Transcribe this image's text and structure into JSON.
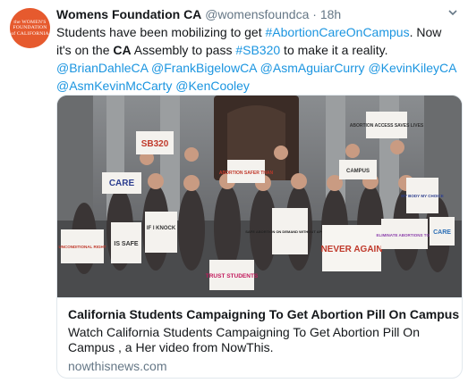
{
  "avatar": {
    "lines": [
      "the WOMEN'S",
      "FOUNDATION",
      "of CALIFORNIA"
    ]
  },
  "tweet": {
    "author_name": "Womens Foundation CA",
    "author_handle": "@womensfoundca",
    "separator": "·",
    "timestamp": "18h",
    "text_parts": [
      {
        "t": "Students have been mobilizing to get ",
        "k": "plain"
      },
      {
        "t": "#AbortionCareOnCampus",
        "k": "link"
      },
      {
        "t": ". Now it's on the ",
        "k": "plain"
      },
      {
        "t": "CA",
        "k": "bold"
      },
      {
        "t": " Assembly to pass ",
        "k": "plain"
      },
      {
        "t": "#SB320",
        "k": "link"
      },
      {
        "t": " to make it a reality. ",
        "k": "plain"
      },
      {
        "t": "@BrianDahleCA",
        "k": "link"
      },
      {
        "t": " ",
        "k": "plain"
      },
      {
        "t": "@FrankBigelowCA",
        "k": "link"
      },
      {
        "t": " ",
        "k": "plain"
      },
      {
        "t": "@AsmAguiarCurry",
        "k": "link"
      },
      {
        "t": "  ",
        "k": "plain"
      },
      {
        "t": "@KevinKileyCA",
        "k": "link"
      },
      {
        "t": " ",
        "k": "plain"
      },
      {
        "t": "@AsmKevinMcCarty",
        "k": "link"
      },
      {
        "t": " ",
        "k": "plain"
      },
      {
        "t": "@KenCooley",
        "k": "link"
      }
    ]
  },
  "card": {
    "title": "California Students Campaigning To Get Abortion Pill On Campus",
    "description": "Watch California Students Campaigning To Get Abortion Pill On Campus , a Her video from NowThis.",
    "domain": "nowthisnews.com"
  },
  "image_signs": [
    {
      "text": "SB320",
      "color": "#c0392b"
    },
    {
      "text": "ABORTION ACCESS SAVES LIVES",
      "color": "#333333"
    },
    {
      "text": "CARE",
      "color": "#2c3e8f"
    },
    {
      "text": "ABORTION SAFER THAN",
      "color": "#c0392b"
    },
    {
      "text": "CAMPUS",
      "color": "#333333"
    },
    {
      "text": "MY BODY MY CHOICE",
      "color": "#2c3e8f"
    },
    {
      "text": "IS SAFE",
      "color": "#333333"
    },
    {
      "text": "IF I KNOCK",
      "color": "#333333"
    },
    {
      "text": "SAFE ABORTION ON DEMAND WITHOUT APOLOGY",
      "color": "#222222"
    },
    {
      "text": "NEVER AGAIN",
      "color": "#c0392b"
    },
    {
      "text": "ELIMINATE ABORTIONS TOO",
      "color": "#8e44ad"
    },
    {
      "text": "CARE",
      "color": "#2c6fb5"
    },
    {
      "text": "TRUST STUDENTS",
      "color": "#c2185b"
    },
    {
      "text": "UNCONDITIONAL RIGHT",
      "color": "#c0392b"
    }
  ],
  "colors": {
    "accent_link": "#1b95e0",
    "avatar_bg": "#e65a2e",
    "text_primary": "#14171a",
    "text_secondary": "#657786",
    "border": "#e1e8ed"
  },
  "icons": {
    "caret": "chevron-down-icon"
  }
}
